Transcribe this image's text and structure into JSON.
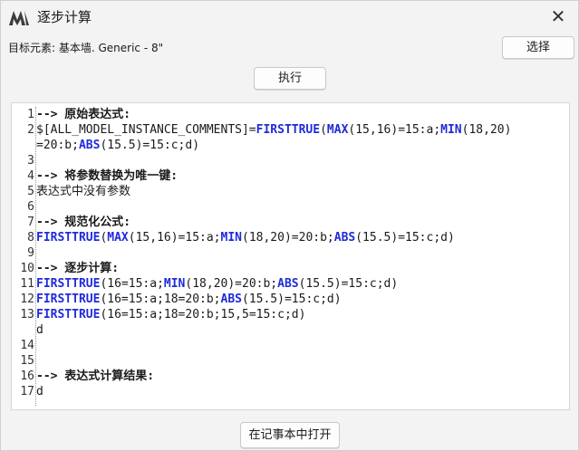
{
  "window": {
    "title": "逐步计算",
    "icon": "app-logo-icon",
    "close_glyph": "✕"
  },
  "target_label": "目标元素: 基本墙. Generic - 8\"",
  "buttons": {
    "select": "选择",
    "run": "执行",
    "open_in_notepad": "在记事本中打开"
  },
  "colors": {
    "function": "#1f2bd9",
    "text": "#1a1a1a",
    "background": "#f3f3f3"
  },
  "editor": {
    "lines": [
      {
        "num": "1",
        "segments": [
          {
            "t": "--> 原始表达式:",
            "c": "hdr"
          }
        ]
      },
      {
        "num": "2",
        "segments": [
          {
            "t": "$[ALL_MODEL_INSTANCE_COMMENTS]=",
            "c": ""
          },
          {
            "t": "FIRSTTRUE",
            "c": "fn"
          },
          {
            "t": "(",
            "c": ""
          },
          {
            "t": "MAX",
            "c": "fn"
          },
          {
            "t": "(15,16)=15:a;",
            "c": ""
          },
          {
            "t": "MIN",
            "c": "fn"
          },
          {
            "t": "(18,20)",
            "c": ""
          }
        ]
      },
      {
        "num": "",
        "segments": [
          {
            "t": "=20:b;",
            "c": ""
          },
          {
            "t": "ABS",
            "c": "fn"
          },
          {
            "t": "(15.5)=15:c;d)",
            "c": ""
          }
        ]
      },
      {
        "num": "3",
        "segments": []
      },
      {
        "num": "4",
        "segments": [
          {
            "t": "--> 将参数替换为唯一键:",
            "c": "hdr"
          }
        ]
      },
      {
        "num": "5",
        "segments": [
          {
            "t": "表达式中没有参数",
            "c": ""
          }
        ]
      },
      {
        "num": "6",
        "segments": []
      },
      {
        "num": "7",
        "segments": [
          {
            "t": "--> 规范化公式:",
            "c": "hdr"
          }
        ]
      },
      {
        "num": "8",
        "segments": [
          {
            "t": "FIRSTTRUE",
            "c": "fn"
          },
          {
            "t": "(",
            "c": ""
          },
          {
            "t": "MAX",
            "c": "fn"
          },
          {
            "t": "(15,16)=15:a;",
            "c": ""
          },
          {
            "t": "MIN",
            "c": "fn"
          },
          {
            "t": "(18,20)=20:b;",
            "c": ""
          },
          {
            "t": "ABS",
            "c": "fn"
          },
          {
            "t": "(15.5)=15:c;d)",
            "c": ""
          }
        ]
      },
      {
        "num": "9",
        "segments": []
      },
      {
        "num": "10",
        "segments": [
          {
            "t": "--> 逐步计算:",
            "c": "hdr"
          }
        ]
      },
      {
        "num": "11",
        "segments": [
          {
            "t": "FIRSTTRUE",
            "c": "fn"
          },
          {
            "t": "(16=15:a;",
            "c": ""
          },
          {
            "t": "MIN",
            "c": "fn"
          },
          {
            "t": "(18,20)=20:b;",
            "c": ""
          },
          {
            "t": "ABS",
            "c": "fn"
          },
          {
            "t": "(15.5)=15:c;d)",
            "c": ""
          }
        ]
      },
      {
        "num": "12",
        "segments": [
          {
            "t": "FIRSTTRUE",
            "c": "fn"
          },
          {
            "t": "(16=15:a;18=20:b;",
            "c": ""
          },
          {
            "t": "ABS",
            "c": "fn"
          },
          {
            "t": "(15.5)=15:c;d)",
            "c": ""
          }
        ]
      },
      {
        "num": "13",
        "segments": [
          {
            "t": "FIRSTTRUE",
            "c": "fn"
          },
          {
            "t": "(16=15:a;18=20:b;15,5=15:c;d)",
            "c": ""
          }
        ]
      },
      {
        "num": "",
        "segments": [
          {
            "t": "d",
            "c": ""
          }
        ]
      },
      {
        "num": "14",
        "segments": []
      },
      {
        "num": "15",
        "segments": []
      },
      {
        "num": "16",
        "segments": [
          {
            "t": "--> 表达式计算结果:",
            "c": "hdr"
          }
        ]
      },
      {
        "num": "17",
        "segments": [
          {
            "t": "d",
            "c": ""
          }
        ]
      }
    ]
  }
}
